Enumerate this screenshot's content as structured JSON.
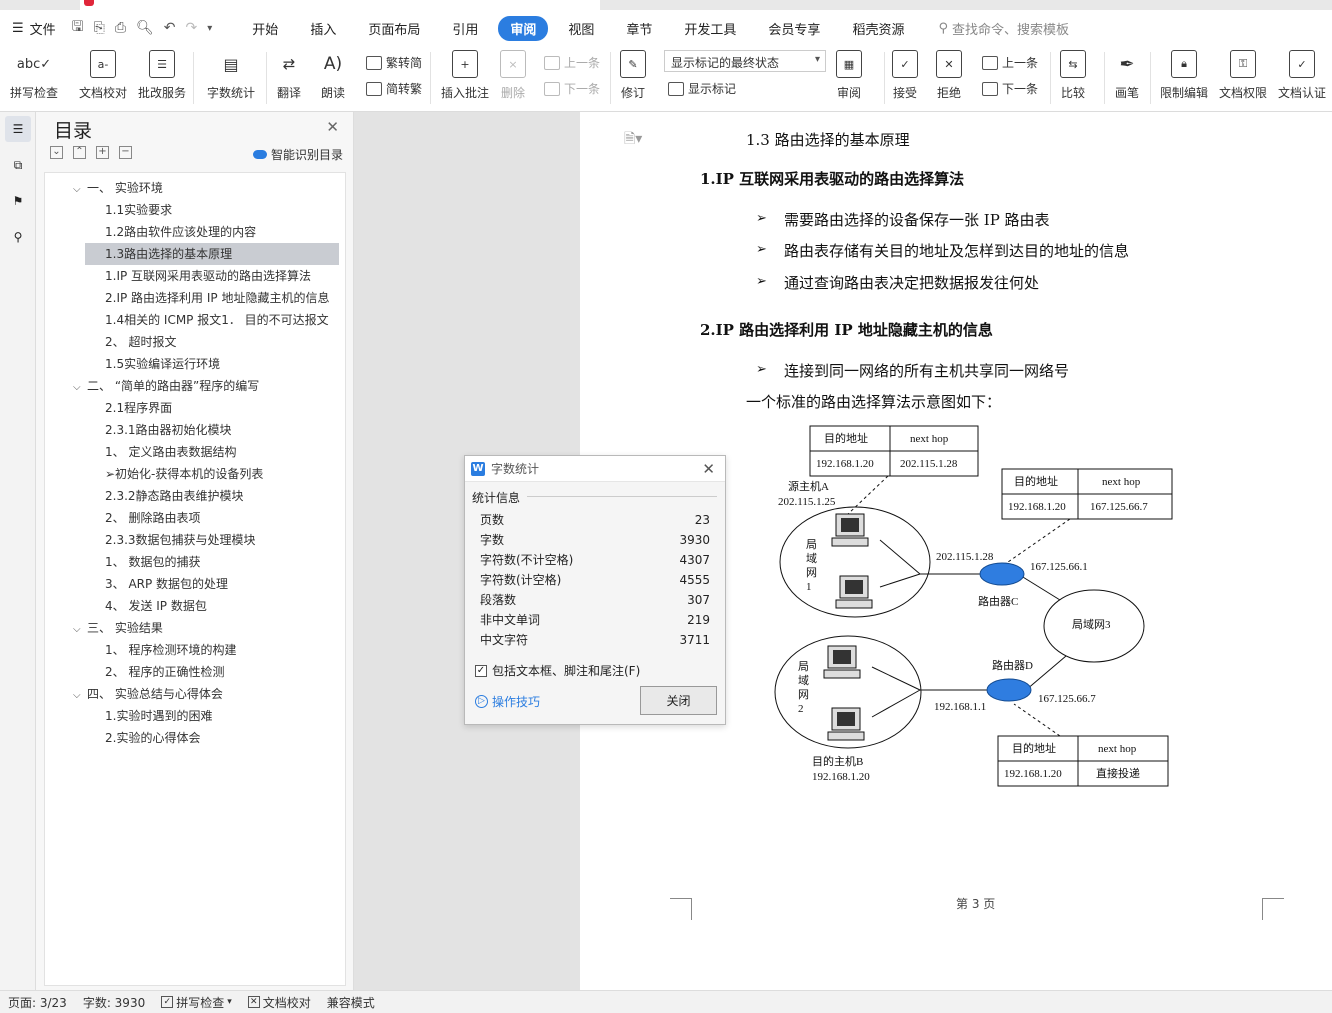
{
  "menubar": {
    "file_label": "文件",
    "tabs": [
      {
        "label": "开始",
        "active": false
      },
      {
        "label": "插入",
        "active": false
      },
      {
        "label": "页面布局",
        "active": false
      },
      {
        "label": "引用",
        "active": false
      },
      {
        "label": "审阅",
        "active": true
      },
      {
        "label": "视图",
        "active": false
      },
      {
        "label": "章节",
        "active": false
      },
      {
        "label": "开发工具",
        "active": false
      },
      {
        "label": "会员专享",
        "active": false
      },
      {
        "label": "稻壳资源",
        "active": false
      }
    ],
    "search_placeholder": "查找命令、搜索模板"
  },
  "ribbon": {
    "spell_check": "拼写检查",
    "doc_proof": "文档校对",
    "batch_service": "批改服务",
    "word_count": "字数统计",
    "translate": "翻译",
    "read_aloud": "朗读",
    "trad_to_simp": "繁转简",
    "simp_to_trad": "简转繁",
    "insert_comment": "插入批注",
    "delete": "删除",
    "prev_comment": "上一条",
    "next_comment": "下一条",
    "revise": "修订",
    "display_mode": "显示标记的最终状态",
    "show_markup": "显示标记",
    "review": "审阅",
    "accept": "接受",
    "reject": "拒绝",
    "prev_change": "上一条",
    "next_change": "下一条",
    "compare": "比较",
    "pen": "画笔",
    "restrict_edit": "限制编辑",
    "doc_permission": "文档权限",
    "doc_auth": "文档认证"
  },
  "toc": {
    "title": "目录",
    "smart_label": "智能识别目录",
    "items": [
      {
        "text": "一、 实验环境",
        "level": 1,
        "expanded": true
      },
      {
        "text": "1.1实验要求",
        "level": 2
      },
      {
        "text": "1.2路由软件应该处理的内容",
        "level": 2
      },
      {
        "text": "1.3路由选择的基本原理",
        "level": 2,
        "selected": true
      },
      {
        "text": "1.IP 互联网采用表驱动的路由选择算法",
        "level": 2
      },
      {
        "text": "2.IP 路由选择利用 IP 地址隐藏主机的信息",
        "level": 2
      },
      {
        "text": "1.4相关的 ICMP 报文1． 目的不可达报文",
        "level": 2
      },
      {
        "text": "2、 超时报文",
        "level": 2
      },
      {
        "text": "1.5实验编译运行环境",
        "level": 2
      },
      {
        "text": "二、 “简单的路由器”程序的编写",
        "level": 1,
        "expanded": true
      },
      {
        "text": "2.1程序界面",
        "level": 2
      },
      {
        "text": "2.3.1路由器初始化模块",
        "level": 2
      },
      {
        "text": "1、 定义路由表数据结构",
        "level": 2
      },
      {
        "text": "➢初始化-获得本机的设备列表",
        "level": 2
      },
      {
        "text": "2.3.2静态路由表维护模块",
        "level": 2
      },
      {
        "text": "2、 删除路由表项",
        "level": 2
      },
      {
        "text": "2.3.3数据包捕获与处理模块",
        "level": 2
      },
      {
        "text": "1、 数据包的捕获",
        "level": 2
      },
      {
        "text": "3、 ARP 数据包的处理",
        "level": 2
      },
      {
        "text": "4、 发送 IP 数据包",
        "level": 2
      },
      {
        "text": "三、 实验结果",
        "level": 1,
        "expanded": true
      },
      {
        "text": "1、 程序检测环境的构建",
        "level": 2
      },
      {
        "text": "2、 程序的正确性检测",
        "level": 2
      },
      {
        "text": "四、 实验总结与心得体会",
        "level": 1,
        "expanded": true
      },
      {
        "text": "1.实验时遇到的困难",
        "level": 2
      },
      {
        "text": "2.实验的心得体会",
        "level": 2
      }
    ]
  },
  "document": {
    "section_heading": "1.3  路由选择的基本原理",
    "heading1": "1.IP 互联网采用表驱动的路由选择算法",
    "bullets1": [
      "需要路由选择的设备保存一张 IP 路由表",
      "路由表存储有关目的地址及怎样到达目的地址的信息",
      "通过查询路由表决定把数据报发往何处"
    ],
    "heading2": "2.IP 路由选择利用 IP 地址隐藏主机的信息",
    "bullets2": [
      "连接到同一网络的所有主机共享同一网络号"
    ],
    "paragraph": "一个标准的路由选择算法示意图如下：",
    "page_label": "第 3 页",
    "diagram": {
      "table_top": {
        "h1": "目的地址",
        "h2": "next hop",
        "v1": "192.168.1.20",
        "v2": "202.115.1.28"
      },
      "table_right": {
        "h1": "目的地址",
        "h2": "next hop",
        "v1": "192.168.1.20",
        "v2": "167.125.66.7"
      },
      "table_bottom": {
        "h1": "目的地址",
        "h2": "next hop",
        "v1": "192.168.1.20",
        "v2": "直接投递"
      },
      "source_host": "源主机A",
      "source_ip": "202.115.1.25",
      "lan1": "局域网1",
      "lan2": "局域网2",
      "lan3": "局域网3",
      "router_c": "路由器C",
      "router_d": "路由器D",
      "ip_c_left": "202.115.1.28",
      "ip_c_right": "167.125.66.1",
      "ip_d_left": "192.168.1.1",
      "ip_d_right": "167.125.66.7",
      "dest_host": "目的主机B",
      "dest_ip": "192.168.1.20"
    }
  },
  "dialog": {
    "title": "字数统计",
    "section": "统计信息",
    "stats": [
      {
        "label": "页数",
        "value": "23"
      },
      {
        "label": "字数",
        "value": "3930"
      },
      {
        "label": "字符数(不计空格)",
        "value": "4307"
      },
      {
        "label": "字符数(计空格)",
        "value": "4555"
      },
      {
        "label": "段落数",
        "value": "307"
      },
      {
        "label": "非中文单词",
        "value": "219"
      },
      {
        "label": "中文字符",
        "value": "3711"
      }
    ],
    "checkbox_label": "包括文本框、脚注和尾注(F)",
    "tips_label": "操作技巧",
    "close_label": "关闭"
  },
  "statusbar": {
    "page": "页面: 3/23",
    "words": "字数: 3930",
    "spell": "拼写检查",
    "proof": "文档校对",
    "compat": "兼容模式"
  },
  "colors": {
    "accent": "#2b7de0",
    "selection": "#c9ccd2"
  }
}
